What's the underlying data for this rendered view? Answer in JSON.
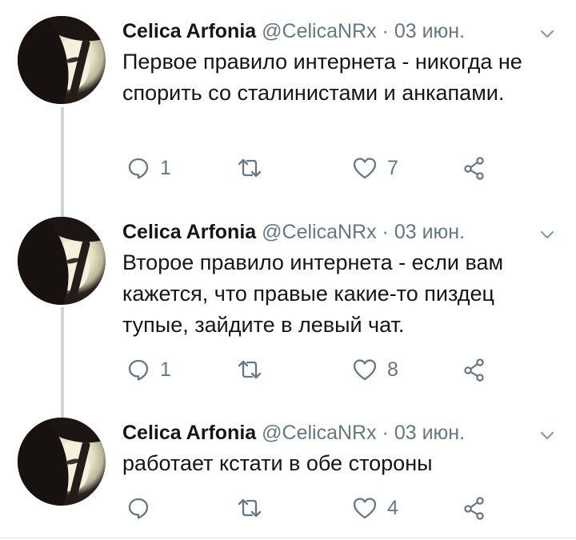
{
  "tweets": [
    {
      "author": "Celica Arfonia",
      "handle": "@CelicaNRx",
      "separator": " · ",
      "date": "03 июн.",
      "text": "Первое правило интернета - никогда не спорить со сталинистами и анкапами.",
      "reply_count": "1",
      "retweet_count": "",
      "like_count": "7"
    },
    {
      "author": "Celica Arfonia",
      "handle": "@CelicaNRx",
      "separator": " · ",
      "date": "03 июн.",
      "text": "Второе правило интернета - если вам кажется, что правые какие-то пиздец тупые, зайдите в левый чат.",
      "reply_count": "1",
      "retweet_count": "",
      "like_count": "8"
    },
    {
      "author": "Celica Arfonia",
      "handle": "@CelicaNRx",
      "separator": " · ",
      "date": "03 июн.",
      "text": "работает кстати в обе стороны",
      "reply_count": "",
      "retweet_count": "",
      "like_count": "4"
    }
  ],
  "icons": {
    "reply": "reply-icon",
    "retweet": "retweet-icon",
    "like": "heart-icon",
    "share": "share-icon",
    "menu": "chevron-down-icon"
  },
  "colors": {
    "text": "#14171a",
    "secondary": "#657786",
    "thread_line": "#ccd6dd"
  }
}
